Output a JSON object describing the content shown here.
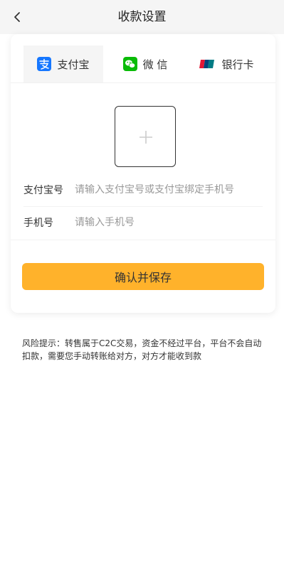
{
  "header": {
    "title": "收款设置",
    "back_icon": "chevron-left-icon"
  },
  "tabs": [
    {
      "label": "支付宝",
      "icon": "alipay-icon",
      "active": true,
      "color": "#1677ff"
    },
    {
      "label": "微 信",
      "icon": "wechat-icon",
      "active": false,
      "color": "#09bb07"
    },
    {
      "label": "银行卡",
      "icon": "unionpay-icon",
      "active": false
    }
  ],
  "upload": {
    "icon": "plus-icon"
  },
  "form": {
    "account": {
      "label": "支付宝号",
      "placeholder": "请输入支付宝号或支付宝绑定手机号",
      "value": ""
    },
    "phone": {
      "label": "手机号",
      "placeholder": "请输入手机号",
      "value": ""
    }
  },
  "confirm_label": "确认并保存",
  "risk_note": "风险提示：转售属于C2C交易，资金不经过平台，平台不会自动扣款，需要您手动转账给对方，对方才能收到款",
  "colors": {
    "accent": "#ffb22b",
    "header_bg": "#f5f5f5"
  }
}
